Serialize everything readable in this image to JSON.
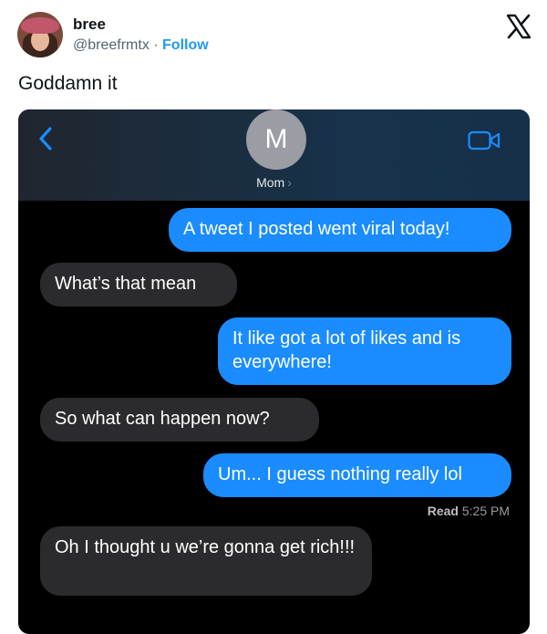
{
  "tweet": {
    "display_name": "bree",
    "handle": "@breefrmtx",
    "separator": " · ",
    "follow_label": "Follow",
    "text": "Goddamn it"
  },
  "conversation": {
    "contact_initial": "M",
    "contact_name": "Mom",
    "messages": [
      {
        "from": "me",
        "text": "A tweet I posted went viral today!"
      },
      {
        "from": "them",
        "text": "What’s that mean"
      },
      {
        "from": "me",
        "text": "It like got a lot of likes and is everywhere!"
      },
      {
        "from": "them",
        "text": "So what can happen now?"
      },
      {
        "from": "me",
        "text": "Um... I guess nothing really lol"
      },
      {
        "from": "them",
        "text": "Oh I thought u we’re gonna get rich!!!"
      }
    ],
    "read_label": "Read",
    "read_time": "5:25 PM"
  },
  "colors": {
    "outgoing_bubble": "#1a8cff",
    "incoming_bubble": "#2b2b2d",
    "follow_link": "#1d9bf0"
  },
  "icons": [
    "x-logo-icon",
    "back-chevron-icon",
    "video-call-icon",
    "chevron-right-icon"
  ]
}
